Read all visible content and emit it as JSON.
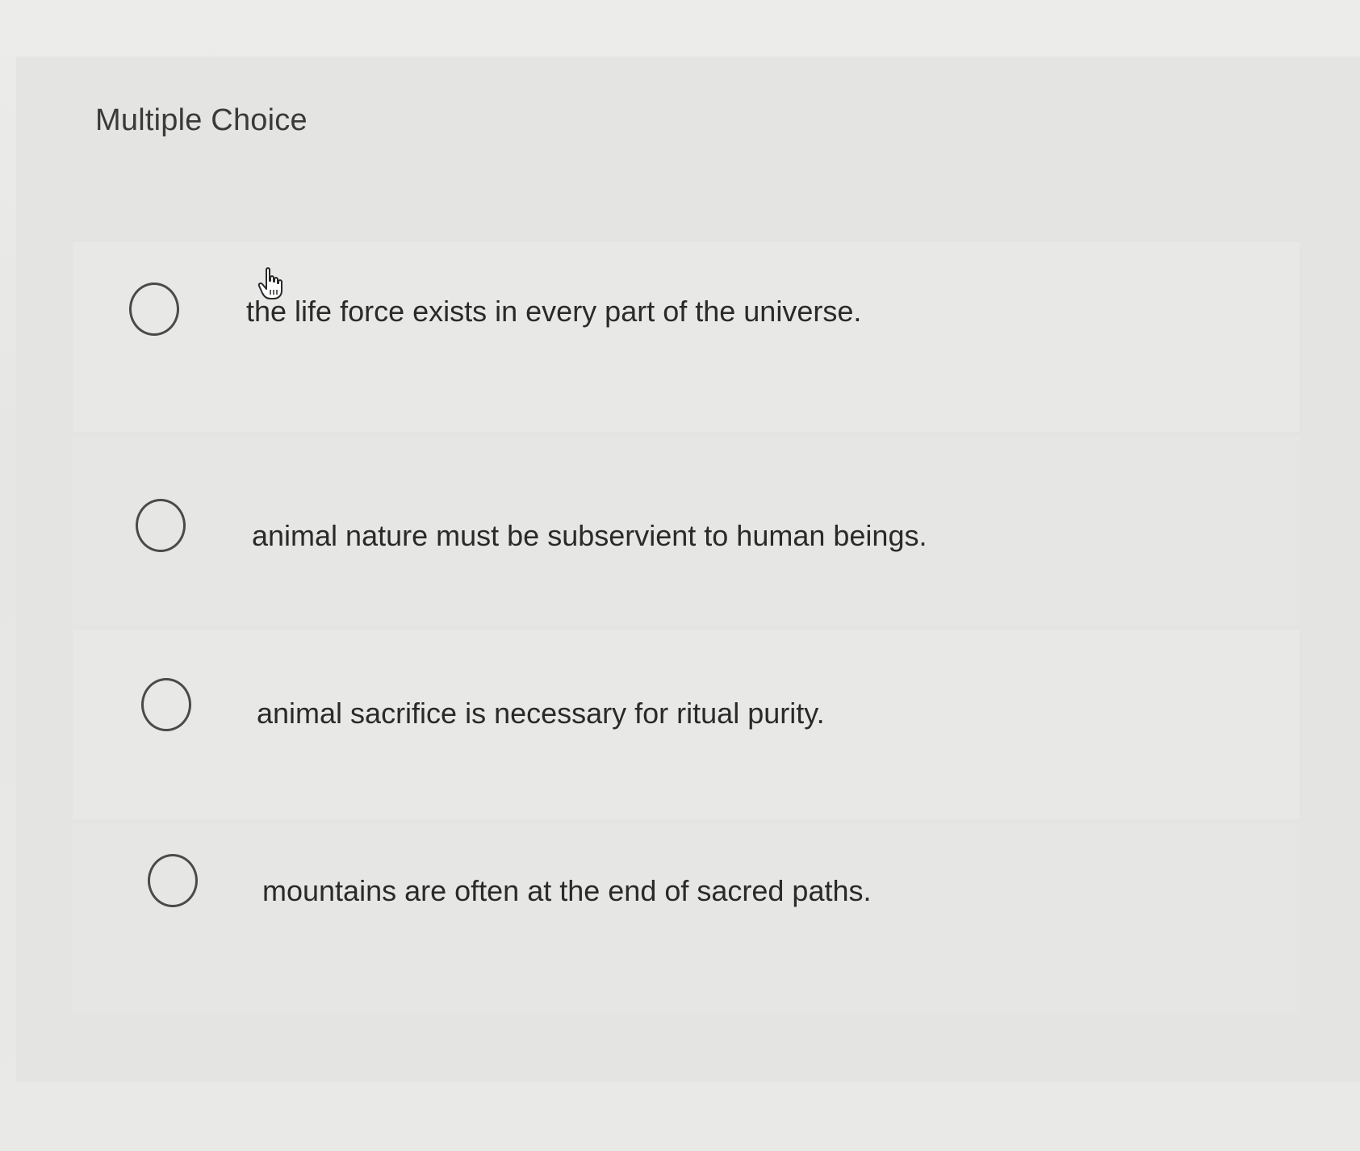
{
  "header": {
    "title": "Multiple Choice"
  },
  "options": [
    {
      "label": "the life force exists in every part of the universe.",
      "selected": false
    },
    {
      "label": "animal nature must be subservient to human beings.",
      "selected": false
    },
    {
      "label": "animal sacrifice is necessary for ritual purity.",
      "selected": false
    },
    {
      "label": "mountains are often at the end of sacred paths.",
      "selected": false
    }
  ],
  "icons": {
    "cursor": "hand-pointer-icon",
    "radio": "radio-circle-icon"
  },
  "colors": {
    "background": "#e9e9e7",
    "text": "#2a2a2a",
    "radio_border": "#4a4a4a"
  }
}
